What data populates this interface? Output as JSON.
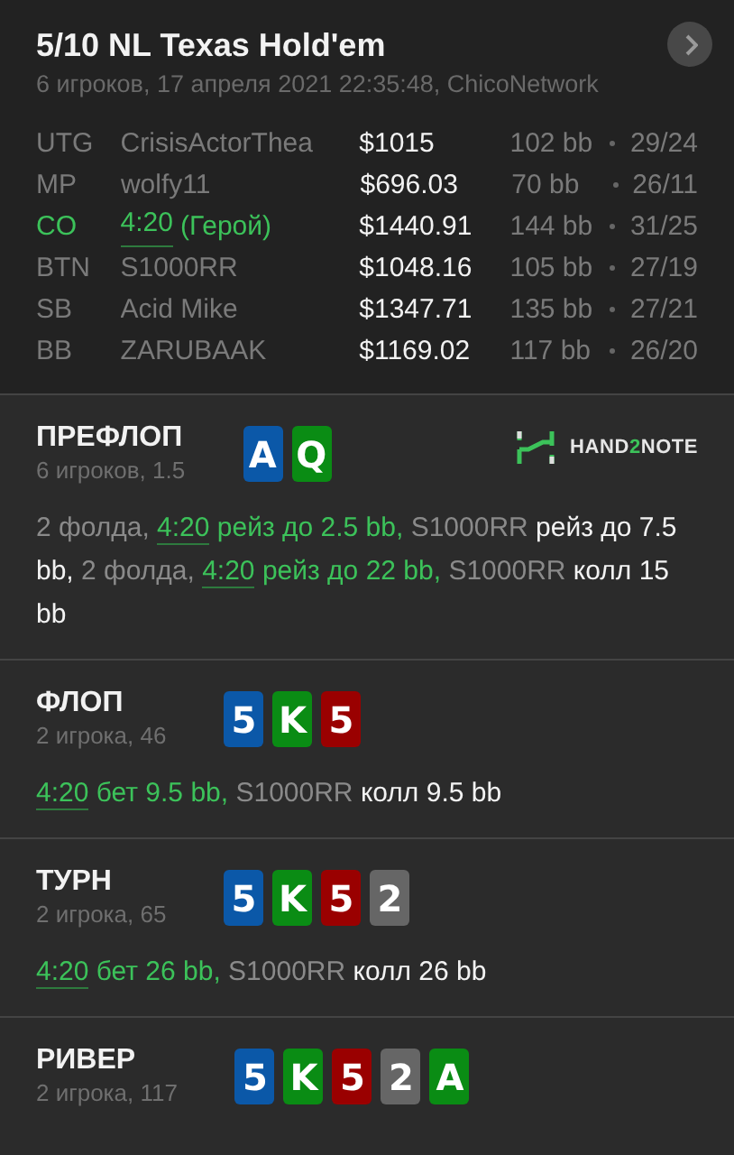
{
  "header": {
    "title": "5/10 NL Texas Hold'em",
    "subtitle": "6 игроков, 17 апреля 2021 22:35:48, ChicoNetwork"
  },
  "players": [
    {
      "position": "UTG",
      "name": "CrisisActorThea",
      "stack": "$1015",
      "bb": "102 bb",
      "stats": "29/24",
      "hero": false
    },
    {
      "position": "MP",
      "name": "wolfy11",
      "stack": "$696.03",
      "bb": "70 bb",
      "stats": "26/11",
      "hero": false
    },
    {
      "position": "CO",
      "name": "4:20",
      "tag": "(Герой)",
      "stack": "$1440.91",
      "bb": "144 bb",
      "stats": "31/25",
      "hero": true
    },
    {
      "position": "BTN",
      "name": "S1000RR",
      "stack": "$1048.16",
      "bb": "105 bb",
      "stats": "27/19",
      "hero": false
    },
    {
      "position": "SB",
      "name": "Acid Mike",
      "stack": "$1347.71",
      "bb": "135 bb",
      "stats": "27/21",
      "hero": false
    },
    {
      "position": "BB",
      "name": "ZARUBAAK",
      "stack": "$1169.02",
      "bb": "117 bb",
      "stats": "26/20",
      "hero": false
    }
  ],
  "logo": {
    "parts": [
      "HAND",
      "2",
      "NOTE"
    ]
  },
  "streets": [
    {
      "title": "ПРЕФЛОП",
      "subtitle": "6 игроков, 1.5",
      "logo": true,
      "cards": [
        {
          "rank": "A",
          "color": "#0b58a8"
        },
        {
          "rank": "Q",
          "color": "#0a8c14"
        }
      ],
      "actions": [
        {
          "kind": "muted",
          "text": "2 фолда, "
        },
        {
          "kind": "hero",
          "text": "4:20"
        },
        {
          "kind": "green",
          "text": " рейз до 2.5 bb, "
        },
        {
          "kind": "muted",
          "text": "S1000RR "
        },
        {
          "kind": "white",
          "text": "рейз до 7.5 bb, "
        },
        {
          "kind": "muted",
          "text": "2 фолда, "
        },
        {
          "kind": "hero",
          "text": "4:20"
        },
        {
          "kind": "green",
          "text": " рейз до 22 bb, "
        },
        {
          "kind": "muted",
          "text": "S1000RR "
        },
        {
          "kind": "white",
          "text": "колл 15 bb"
        }
      ]
    },
    {
      "title": "ФЛОП",
      "subtitle": "2 игрока, 46",
      "logo": false,
      "cards": [
        {
          "rank": "5",
          "color": "#0b58a8"
        },
        {
          "rank": "K",
          "color": "#0a8c14"
        },
        {
          "rank": "5",
          "color": "#9a0000"
        }
      ],
      "actions": [
        {
          "kind": "hero",
          "text": "4:20"
        },
        {
          "kind": "green",
          "text": " бет 9.5 bb, "
        },
        {
          "kind": "muted",
          "text": "S1000RR "
        },
        {
          "kind": "white",
          "text": "колл 9.5 bb"
        }
      ]
    },
    {
      "title": "ТУРН",
      "subtitle": "2 игрока, 65",
      "logo": false,
      "cards": [
        {
          "rank": "5",
          "color": "#0b58a8"
        },
        {
          "rank": "K",
          "color": "#0a8c14"
        },
        {
          "rank": "5",
          "color": "#9a0000"
        },
        {
          "rank": "2",
          "color": "#666666"
        }
      ],
      "actions": [
        {
          "kind": "hero",
          "text": "4:20"
        },
        {
          "kind": "green",
          "text": " бет 26 bb, "
        },
        {
          "kind": "muted",
          "text": "S1000RR "
        },
        {
          "kind": "white",
          "text": "колл 26 bb"
        }
      ]
    },
    {
      "title": "РИВЕР",
      "subtitle": "2 игрока, 117",
      "logo": false,
      "cards": [
        {
          "rank": "5",
          "color": "#0b58a8"
        },
        {
          "rank": "K",
          "color": "#0a8c14"
        },
        {
          "rank": "5",
          "color": "#9a0000"
        },
        {
          "rank": "2",
          "color": "#666666"
        },
        {
          "rank": "A",
          "color": "#0a8c14"
        }
      ]
    }
  ]
}
